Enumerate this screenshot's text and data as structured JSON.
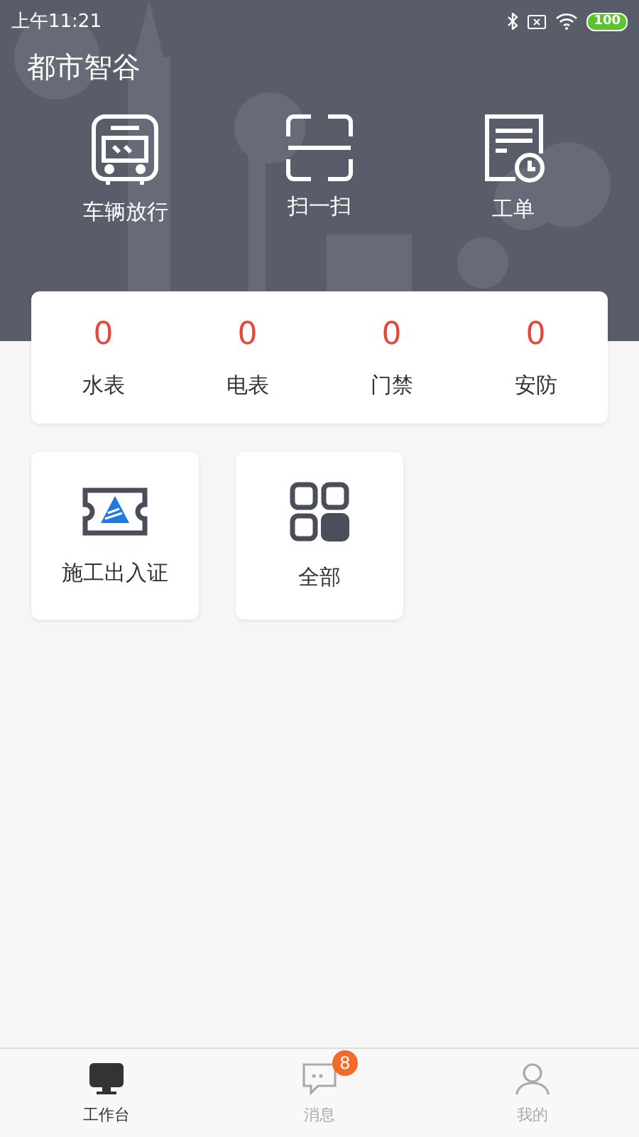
{
  "status_bar": {
    "time": "上午11:21",
    "battery": "100"
  },
  "header": {
    "title": "都市智谷"
  },
  "quick_actions": [
    {
      "kind": "bus",
      "label": "车辆放行"
    },
    {
      "kind": "scan",
      "label": "扫一扫"
    },
    {
      "kind": "order",
      "label": "工单"
    }
  ],
  "stats": [
    {
      "value": "0",
      "label": "水表"
    },
    {
      "value": "0",
      "label": "电表"
    },
    {
      "value": "0",
      "label": "门禁"
    },
    {
      "value": "0",
      "label": "安防"
    }
  ],
  "tiles": [
    {
      "kind": "permit",
      "label": "施工出入证"
    },
    {
      "kind": "all",
      "label": "全部"
    }
  ],
  "tab_bar": [
    {
      "kind": "desk",
      "label": "工作台",
      "selected": true
    },
    {
      "kind": "chat",
      "label": "消息",
      "selected": false,
      "badge": "8"
    },
    {
      "kind": "user",
      "label": "我的",
      "selected": false
    }
  ]
}
